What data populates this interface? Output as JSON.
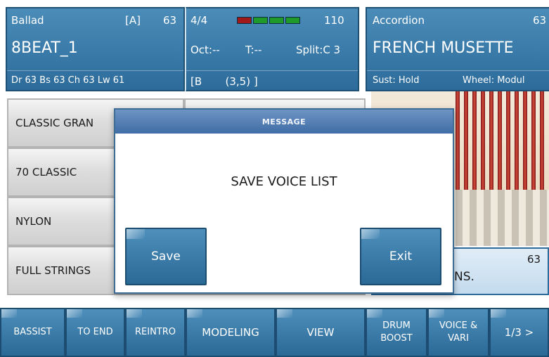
{
  "header": {
    "style": {
      "name": "Ballad",
      "variation": "[A]",
      "number": "63",
      "title": "8BEAT_1",
      "volumes": "Dr 63  Bs 63  Ch 63  Lw 61"
    },
    "center": {
      "time_signature": "4/4",
      "tempo": "110",
      "octave": "Oct:--",
      "transpose": "T:--",
      "split": "Split:C 3",
      "chord_line": "[B       (3,5) ]",
      "meter_colors": [
        "#a01818",
        "#1f9a2a",
        "#1f9a2a",
        "#1f9a2a"
      ]
    },
    "voice": {
      "category": "Accordion",
      "number": "63",
      "name": "FRENCH MUSETTE",
      "sustain": "Sust: Hold",
      "wheel": "Wheel: Modul"
    }
  },
  "voice_list": {
    "left": [
      "CLASSIC GRAN",
      "70 CLASSIC",
      "NYLON",
      "FULL STRINGS"
    ],
    "right": [
      "",
      "",
      "",
      ""
    ]
  },
  "info_panel": {
    "text": "NS.",
    "number": "63"
  },
  "dialog": {
    "title": "MESSAGE",
    "message": "SAVE VOICE LIST",
    "save_label": "Save",
    "exit_label": "Exit"
  },
  "toolbar": {
    "buttons": [
      "BASSIST",
      "TO END",
      "REINTRO",
      "MODELING",
      "VIEW",
      "DRUM\nBOOST",
      "VOICE &\nVARI",
      "1/3 >"
    ]
  },
  "colors": {
    "accent_blue": "#2c6b9a",
    "dialog_title": "#3f6da6"
  }
}
